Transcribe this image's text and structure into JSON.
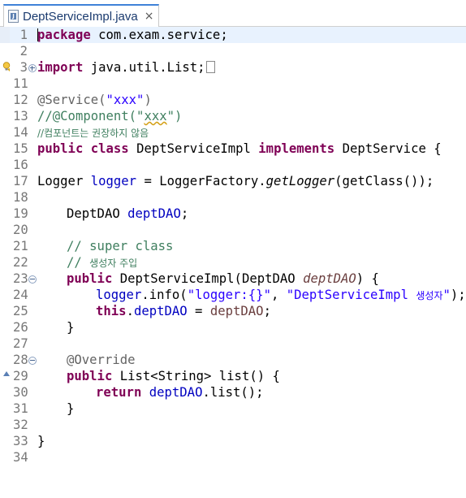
{
  "tab": {
    "filename": "DeptServiceImpl.java",
    "close_glyph": "×"
  },
  "lines": {
    "l1": {
      "num": "1",
      "pkg_kw": "package",
      "rest": " com.exam.service;"
    },
    "l2": {
      "num": "2"
    },
    "l3": {
      "num": "3",
      "imp_kw": "import",
      "rest": " java.util.List;"
    },
    "l11": {
      "num": "11"
    },
    "l12": {
      "num": "12",
      "ann": "@Service(",
      "str": "\"xxx\"",
      "tail": ")"
    },
    "l13": {
      "num": "13",
      "cmt_a": "//@Component(\"",
      "cmt_b": "xxx",
      "cmt_c": "\")"
    },
    "l14": {
      "num": "14",
      "cmt": "//컴포넌트는 권장하지 않음"
    },
    "l15": {
      "num": "15",
      "kw1": "public",
      "kw2": "class",
      "name": " DeptServiceImpl ",
      "kw3": "implements",
      "rest": " DeptService {"
    },
    "l16": {
      "num": "16"
    },
    "l17": {
      "num": "17",
      "a": "Logger ",
      "fld": "logger",
      "b": " = LoggerFactory.",
      "m": "getLogger",
      "c": "(getClass());"
    },
    "l18": {
      "num": "18"
    },
    "l19": {
      "num": "19",
      "a": "DeptDAO ",
      "fld": "deptDAO",
      "b": ";"
    },
    "l20": {
      "num": "20"
    },
    "l21": {
      "num": "21",
      "cmt": "// super class"
    },
    "l22": {
      "num": "22",
      "cmt_a": "// ",
      "cmt_b": "생성자 주입"
    },
    "l23": {
      "num": "23",
      "kw": "public",
      "a": " DeptServiceImpl(DeptDAO ",
      "param": "deptDAO",
      "b": ") {"
    },
    "l24": {
      "num": "24",
      "fld": "logger",
      "a": ".info(",
      "s1": "\"logger:{}\"",
      "b": ", ",
      "s2a": "\"DeptServiceImpl ",
      "s2b": "생성자",
      "s2c": "\"",
      "c": ");"
    },
    "l25": {
      "num": "25",
      "kw": "this",
      "a": ".",
      "fld": "deptDAO",
      "b": " = ",
      "param": "deptDAO",
      "c": ";"
    },
    "l26": {
      "num": "26",
      "a": "}"
    },
    "l27": {
      "num": "27"
    },
    "l28": {
      "num": "28",
      "ann": "@Override"
    },
    "l29": {
      "num": "29",
      "kw": "public",
      "a": " List<String> list() {"
    },
    "l30": {
      "num": "30",
      "kw": "return",
      "a": " ",
      "fld": "deptDAO",
      "b": ".list();"
    },
    "l31": {
      "num": "31",
      "a": "}"
    },
    "l32": {
      "num": "32"
    },
    "l33": {
      "num": "33",
      "a": "}"
    },
    "l34": {
      "num": "34"
    }
  },
  "colors": {
    "keyword": "#7f0055",
    "string": "#2a00ff",
    "comment": "#3f7f5f",
    "field": "#0000c0",
    "annotation": "#646464",
    "current_line": "#e8f2fe"
  },
  "icons": {
    "tab": "java-file-icon",
    "line3": "warning-lightbulb-icon",
    "line29": "override-triangle-icon"
  }
}
